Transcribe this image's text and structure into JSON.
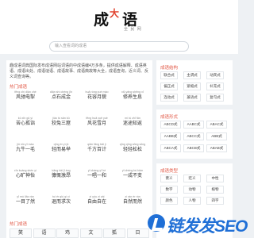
{
  "logo": {
    "c1": "成",
    "c2": "大",
    "c3": "语",
    "sub": "全 民 网"
  },
  "search": {
    "placeholder": "输入查看词的成语"
  },
  "intro": "趣成语词典国际发布成语网站词语的中成语编4万多条，提供成语解释、成语英语、成语出处、成语谜语、成语故事、成语典故等大全，成语查询，近义词、反义词查询等。",
  "sections": {
    "hot_idioms": "热门成语",
    "hot_chars": "热门成语",
    "structure": "成语结构",
    "pattern": "成语形式",
    "type": "成语类型"
  },
  "idioms": [
    {
      "py": "fēng chí diàn chè",
      "w": "风驰电掣"
    },
    {
      "py": "diǎn shí chéng jīn",
      "w": "点石成金"
    },
    {
      "py": "huā róng yuè mào",
      "w": "花容月貌"
    },
    {
      "py": "xiū yǎng shēng xī",
      "w": "修养生息"
    },
    {
      "py": "kǔ xīn gū yì",
      "w": "苦心孤诣"
    },
    {
      "py": "jiǎo tù sān kū",
      "w": "狡兔三窟"
    },
    {
      "py": "fēng huā xuě yuè",
      "w": "风花雪月"
    },
    {
      "py": "mí tú zhī fǎn",
      "w": "迷途知返"
    },
    {
      "py": "jiǔ niú yī máo",
      "w": "九牛一毛"
    },
    {
      "py": "qīng ér yì jǔ",
      "w": "轻而易举"
    },
    {
      "py": "qiān fāng bǎi jì",
      "w": "千方百计"
    },
    {
      "py": "qīng qīng sōng sōng",
      "w": "轻轻松松"
    },
    {
      "py": "xīn kuàng shén yí",
      "w": "心旷神怡"
    },
    {
      "py": "kāng kǎi jī áng",
      "w": "慷慨激昂"
    },
    {
      "py": "yī chàng yī hè",
      "w": "一唱一和"
    },
    {
      "py": "yī chéng bù biàn",
      "w": "一成不变"
    },
    {
      "py": "yī mù liǎo rán",
      "w": "一目了然"
    },
    {
      "py": "tuì ér qiú qí cì",
      "w": "退而求次"
    },
    {
      "py": "zì yóu zì zài",
      "w": "自由自在"
    },
    {
      "py": "zì rán ér rán",
      "w": "自然而然"
    }
  ],
  "chars": [
    "笑",
    "语",
    "鸡",
    "文",
    "狐",
    "日",
    "冬",
    "青",
    "悦",
    "水",
    "风",
    "天",
    "春",
    "月",
    "德",
    "行",
    "欢",
    "花"
  ],
  "structure_tags": [
    "联合式",
    "主谓式",
    "动宾式",
    "偏正式",
    "紧缩式",
    "补充式",
    "连动式",
    "兼语式",
    "复句式"
  ],
  "pattern_tags": [
    "ABCD式",
    "AABC式",
    "ABAC式",
    "AABB式",
    "ABCC式",
    "ABB式",
    "ABCA式",
    "ABCB式",
    "ABAB式"
  ],
  "type_tags": [
    "褒义",
    "贬义",
    "中性",
    "数字",
    "动物",
    "植物",
    "颜色",
    "人物",
    "四字"
  ],
  "watermark": "链发发SEO",
  "colors": {
    "accent": "#e25a48",
    "watermark": "#1f6fd6"
  }
}
